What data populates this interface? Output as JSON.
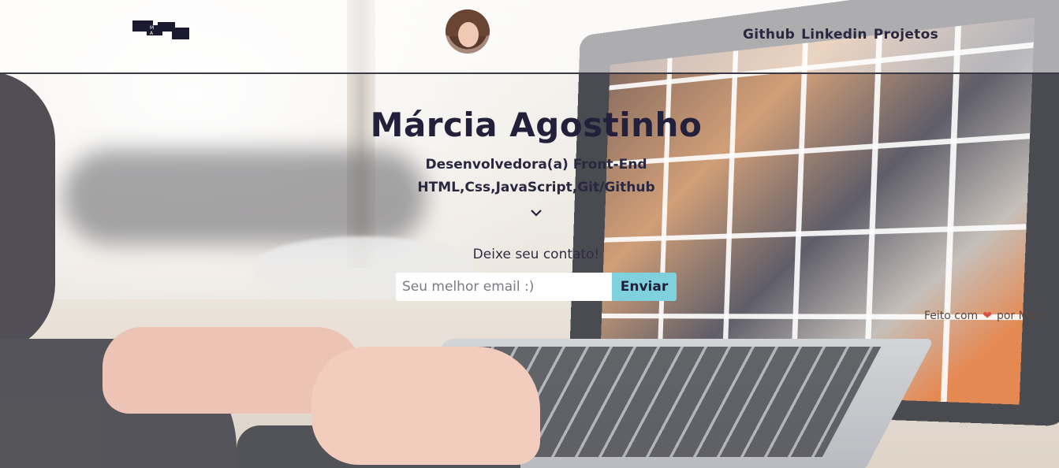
{
  "header": {
    "logo_text": "M A",
    "nav": [
      "Github",
      "Linkedin",
      "Projetos"
    ]
  },
  "hero": {
    "name": "Márcia Agostinho",
    "role": "Desenvolvedora(a) Front-End",
    "stack": "HTML,Css,JavaScript,Git/Github"
  },
  "contact": {
    "label": "Deixe seu contato!",
    "email_placeholder": "Seu melhor email :)",
    "email_value": "",
    "submit_label": "Enviar"
  },
  "footer": {
    "prefix": "Feito com",
    "heart": "❤",
    "suffix": "por Márc"
  },
  "colors": {
    "accent_button": "#7fd2dd",
    "text_dark": "#22203a",
    "heart": "#d9503f"
  }
}
